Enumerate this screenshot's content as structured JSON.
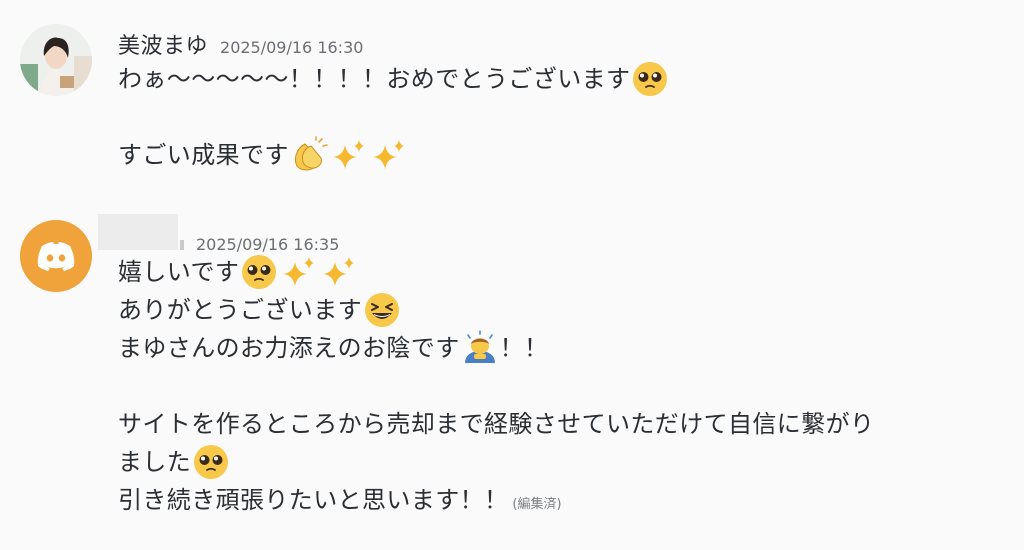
{
  "messages": [
    {
      "username": "美波まゆ",
      "timestamp": "2025/09/16 16:30",
      "avatar_icon": "user-photo-avatar",
      "lines": [
        {
          "text": "わぁ〜〜〜〜〜！！！！おめでとうございます",
          "emoji": [
            "pleading-face-icon"
          ]
        },
        {
          "text": "",
          "emoji": []
        },
        {
          "text": "すごい成果です",
          "emoji": [
            "clapping-hands-icon",
            "sparkles-icon",
            "sparkles-icon"
          ]
        }
      ]
    },
    {
      "username": "",
      "timestamp": "2025/09/16 16:35",
      "avatar_icon": "discord-logo-avatar",
      "lines": [
        {
          "text": "嬉しいです",
          "emoji": [
            "pleading-face-icon",
            "sparkles-icon",
            "sparkles-icon"
          ]
        },
        {
          "text": "ありがとうございます",
          "emoji": [
            "grinning-squinting-face-icon"
          ]
        },
        {
          "text": "まゆさんのお力添えのお陰です",
          "emoji": [
            "bowing-man-icon"
          ],
          "trailing": "！！"
        },
        {
          "text": "",
          "emoji": []
        },
        {
          "text": "サイトを作るところから売却まで経験させていただけて自信に繋がり",
          "emoji": []
        },
        {
          "text": "ました",
          "emoji": [
            "pleading-face-icon"
          ]
        },
        {
          "text": "引き続き頑張りたいと思います！！",
          "emoji": [],
          "edited": "(編集済)"
        }
      ]
    }
  ],
  "colors": {
    "background": "#fafafa",
    "discord_avatar": "#f0a33b",
    "text": "#2b2f33",
    "timestamp": "#6b6f73"
  }
}
